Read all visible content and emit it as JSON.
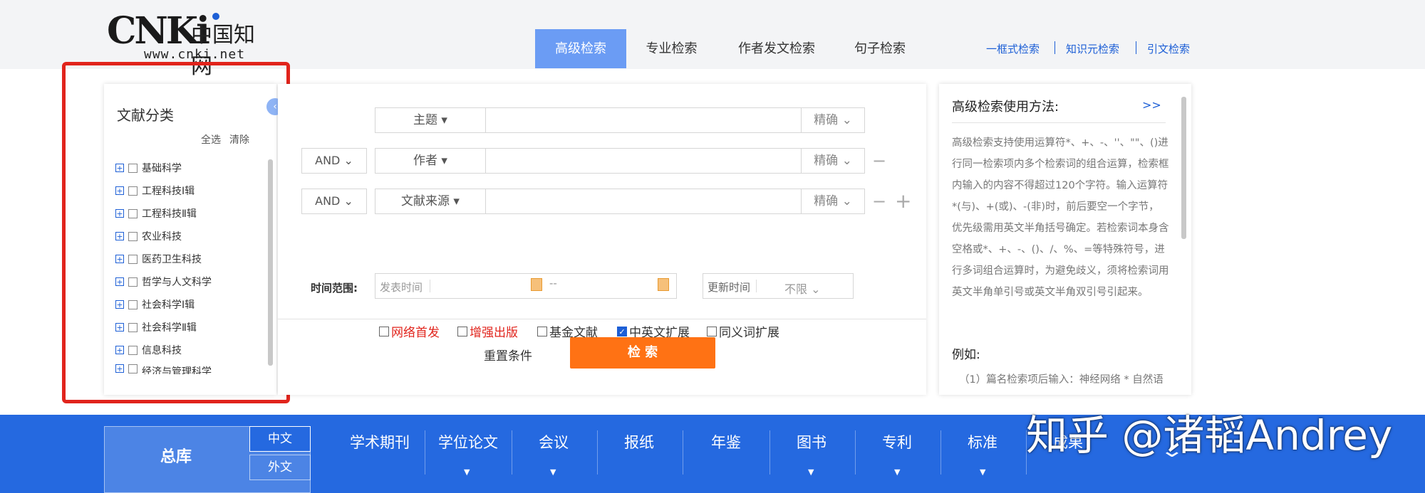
{
  "header": {
    "logo_mark": "CNKi",
    "logo_cn": "中国知网",
    "logo_url": "www.cnki.net",
    "tabs": [
      {
        "label": "高级检索",
        "active": true
      },
      {
        "label": "专业检索"
      },
      {
        "label": "作者发文检索"
      },
      {
        "label": "句子检索"
      }
    ],
    "links": [
      "一框式检索",
      "知识元检索",
      "引文检索"
    ]
  },
  "left_panel": {
    "title": "文献分类",
    "select_all": "全选",
    "clear": "清除",
    "categories": [
      "基础科学",
      "工程科技Ⅰ辑",
      "工程科技Ⅱ辑",
      "农业科技",
      "医药卫生科技",
      "哲学与人文科学",
      "社会科学Ⅰ辑",
      "社会科学Ⅱ辑",
      "信息科技",
      "经济与管理科学"
    ]
  },
  "form": {
    "rows": [
      {
        "logic": "",
        "field": "主题",
        "precision": "精确"
      },
      {
        "logic": "AND",
        "field": "作者",
        "precision": "精确"
      },
      {
        "logic": "AND",
        "field": "文献来源",
        "precision": "精确"
      }
    ],
    "options": [
      {
        "label": "网络首发",
        "checked": false,
        "color": "#e1241c"
      },
      {
        "label": "增强出版",
        "checked": false,
        "color": "#e1241c"
      },
      {
        "label": "基金文献",
        "checked": false,
        "color": "#333333"
      },
      {
        "label": "中英文扩展",
        "checked": true,
        "color": "#333333"
      },
      {
        "label": "同义词扩展",
        "checked": false,
        "color": "#333333"
      }
    ],
    "time_label": "时间范围:",
    "publish_time_placeholder": "发表时间",
    "date_separator": "--",
    "update_time_label": "更新时间",
    "update_time_value": "不限",
    "reset_label": "重置条件",
    "search_label": "检 索",
    "accent_color": "#ff7214"
  },
  "help": {
    "title": "高级检索使用方法:",
    "more": ">>",
    "body": "高级检索支持使用运算符*、+、-、''、\"\"、()进行同一检索项内多个检索词的组合运算，检索框内输入的内容不得超过120个字符。输入运算符*(与)、+(或)、-(非)时，前后要空一个字节，优先级需用英文半角括号确定。若检索词本身含空格或*、+、-、()、/、%、=等特殊符号，进行多词组合运算时，为避免歧义，须将检索词用英文半角单引号或英文半角双引号引起来。",
    "example_title": "例如:",
    "example_1": "（1）篇名检索项后输入：神经网络 * 自然语"
  },
  "bottom_bar": {
    "main": "总库",
    "lang_cn": "中文",
    "lang_foreign": "外文",
    "tabs": [
      "学术期刊",
      "学位论文",
      "会议",
      "报纸",
      "年鉴",
      "图书",
      "专利",
      "标准",
      "成果"
    ]
  },
  "watermark": "知乎 @诸韬Andrey"
}
